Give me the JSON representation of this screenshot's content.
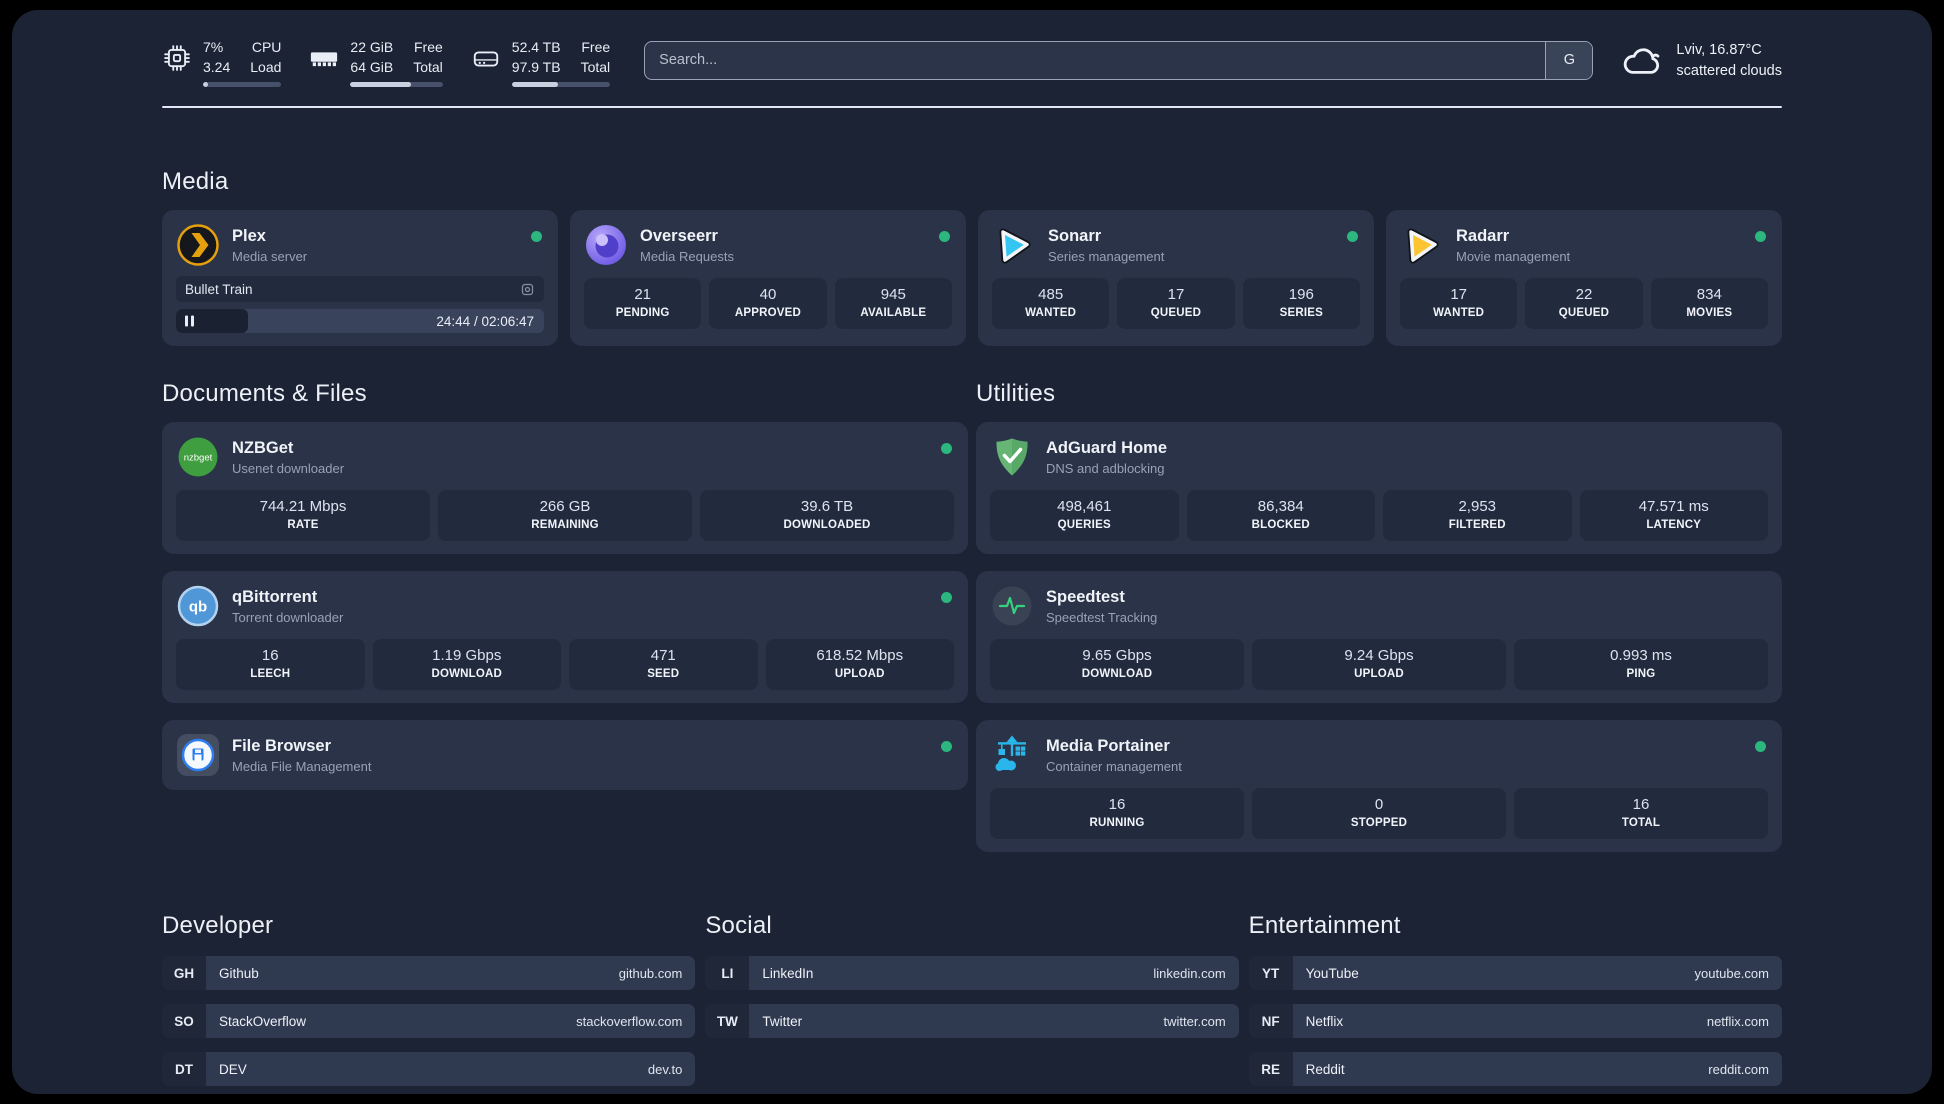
{
  "header": {
    "cpu": {
      "icon": "cpu-icon",
      "value_top": "7%",
      "value_bottom": "3.24",
      "label_top": "CPU",
      "label_bottom": "Load",
      "bar_style": "width:7%"
    },
    "ram": {
      "icon": "ram-icon",
      "value_top": "22 GiB",
      "value_bottom": "64 GiB",
      "label_top": "Free",
      "label_bottom": "Total",
      "bar_style": "width:66%"
    },
    "disk": {
      "icon": "hdd-icon",
      "value_top": "52.4 TB",
      "value_bottom": "97.9 TB",
      "label_top": "Free",
      "label_bottom": "Total",
      "bar_style": "width:47%"
    },
    "search": {
      "placeholder": "Search...",
      "button": "G"
    },
    "weather": {
      "icon": "cloud-icon",
      "line1": "Lviv, 16.87°C",
      "line2": "scattered clouds"
    }
  },
  "sections": {
    "media": "Media",
    "documents": "Documents & Files",
    "utilities": "Utilities",
    "developer": "Developer",
    "social": "Social",
    "entertainment": "Entertainment"
  },
  "apps": {
    "plex": {
      "name": "Plex",
      "subtitle": "Media server",
      "now_playing": "Bullet Train",
      "progress_style": "width:19.5%",
      "time": "24:44 / 02:06:47"
    },
    "overseerr": {
      "name": "Overseerr",
      "subtitle": "Media Requests",
      "stats": [
        {
          "value": "21",
          "label": "PENDING"
        },
        {
          "value": "40",
          "label": "APPROVED"
        },
        {
          "value": "945",
          "label": "AVAILABLE"
        }
      ]
    },
    "sonarr": {
      "name": "Sonarr",
      "subtitle": "Series management",
      "stats": [
        {
          "value": "485",
          "label": "WANTED"
        },
        {
          "value": "17",
          "label": "QUEUED"
        },
        {
          "value": "196",
          "label": "SERIES"
        }
      ]
    },
    "radarr": {
      "name": "Radarr",
      "subtitle": "Movie management",
      "stats": [
        {
          "value": "17",
          "label": "WANTED"
        },
        {
          "value": "22",
          "label": "QUEUED"
        },
        {
          "value": "834",
          "label": "MOVIES"
        }
      ]
    },
    "nzbget": {
      "name": "NZBGet",
      "subtitle": "Usenet downloader",
      "stats": [
        {
          "value": "744.21 Mbps",
          "label": "RATE"
        },
        {
          "value": "266 GB",
          "label": "REMAINING"
        },
        {
          "value": "39.6 TB",
          "label": "DOWNLOADED"
        }
      ]
    },
    "adguard": {
      "name": "AdGuard Home",
      "subtitle": "DNS and adblocking",
      "stats": [
        {
          "value": "498,461",
          "label": "QUERIES"
        },
        {
          "value": "86,384",
          "label": "BLOCKED"
        },
        {
          "value": "2,953",
          "label": "FILTERED"
        },
        {
          "value": "47.571 ms",
          "label": "LATENCY"
        }
      ]
    },
    "qbittorrent": {
      "name": "qBittorrent",
      "subtitle": "Torrent downloader",
      "stats": [
        {
          "value": "16",
          "label": "LEECH"
        },
        {
          "value": "1.19 Gbps",
          "label": "DOWNLOAD"
        },
        {
          "value": "471",
          "label": "SEED"
        },
        {
          "value": "618.52 Mbps",
          "label": "UPLOAD"
        }
      ]
    },
    "speedtest": {
      "name": "Speedtest",
      "subtitle": "Speedtest Tracking",
      "stats": [
        {
          "value": "9.65 Gbps",
          "label": "DOWNLOAD"
        },
        {
          "value": "9.24 Gbps",
          "label": "UPLOAD"
        },
        {
          "value": "0.993 ms",
          "label": "PING"
        }
      ]
    },
    "filebrowser": {
      "name": "File Browser",
      "subtitle": "Media File Management"
    },
    "portainer": {
      "name": "Media Portainer",
      "subtitle": "Container management",
      "stats": [
        {
          "value": "16",
          "label": "RUNNING"
        },
        {
          "value": "0",
          "label": "STOPPED"
        },
        {
          "value": "16",
          "label": "TOTAL"
        }
      ]
    }
  },
  "links": {
    "developer": [
      {
        "abbr": "GH",
        "name": "Github",
        "url": "github.com"
      },
      {
        "abbr": "SO",
        "name": "StackOverflow",
        "url": "stackoverflow.com"
      },
      {
        "abbr": "DT",
        "name": "DEV",
        "url": "dev.to"
      }
    ],
    "social": [
      {
        "abbr": "LI",
        "name": "LinkedIn",
        "url": "linkedin.com"
      },
      {
        "abbr": "TW",
        "name": "Twitter",
        "url": "twitter.com"
      }
    ],
    "entertainment": [
      {
        "abbr": "YT",
        "name": "YouTube",
        "url": "youtube.com"
      },
      {
        "abbr": "NF",
        "name": "Netflix",
        "url": "netflix.com"
      },
      {
        "abbr": "RE",
        "name": "Reddit",
        "url": "reddit.com"
      }
    ]
  },
  "colors": {
    "background": "#1b2334",
    "card": "#2a3347",
    "stat_box": "#222b3e",
    "status_online": "#2bb77d",
    "divider": "#e2e8f3",
    "plex_accent": "#e5a00d",
    "sonarr_accent": "#35c5f1",
    "radarr_accent": "#fdc431",
    "portainer_accent": "#2ab6ea"
  }
}
